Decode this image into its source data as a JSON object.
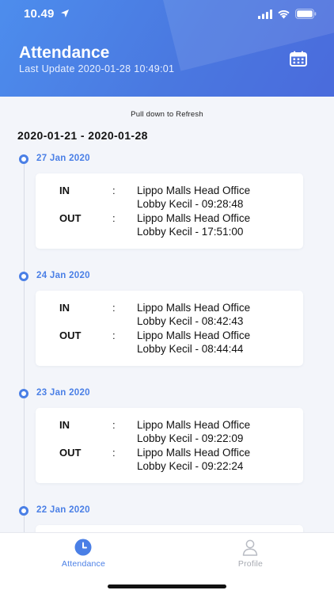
{
  "status_bar": {
    "time": "10.49"
  },
  "header": {
    "title": "Attendance",
    "last_update": "Last Update 2020-01-28 10:49:01"
  },
  "content": {
    "refresh_hint": "Pull down to Refresh",
    "date_range": "2020-01-21 - 2020-01-28",
    "days": [
      {
        "date": "27 Jan 2020",
        "in_label": "IN",
        "in_value": "Lippo Malls Head Office\nLobby Kecil - 09:28:48",
        "out_label": "OUT",
        "out_value": "Lippo Malls Head Office\nLobby Kecil - 17:51:00"
      },
      {
        "date": "24 Jan 2020",
        "in_label": "IN",
        "in_value": "Lippo Malls Head Office\nLobby Kecil - 08:42:43",
        "out_label": "OUT",
        "out_value": "Lippo Malls Head Office\nLobby Kecil - 08:44:44"
      },
      {
        "date": "23 Jan 2020",
        "in_label": "IN",
        "in_value": "Lippo Malls Head Office\nLobby Kecil - 09:22:09",
        "out_label": "OUT",
        "out_value": "Lippo Malls Head Office\nLobby Kecil - 09:22:24"
      },
      {
        "date": "22 Jan 2020"
      }
    ],
    "colon": ":"
  },
  "bottom_nav": {
    "attendance_label": "Attendance",
    "profile_label": "Profile"
  },
  "colors": {
    "accent": "#4a7fe6",
    "header_gradient_start": "#4d8ded",
    "header_gradient_end": "#4a6bdc",
    "inactive": "#b9bcc4",
    "background": "#f3f5fa"
  },
  "icons": {
    "calendar": "calendar-icon",
    "attendance": "clock-icon",
    "profile": "user-icon"
  }
}
